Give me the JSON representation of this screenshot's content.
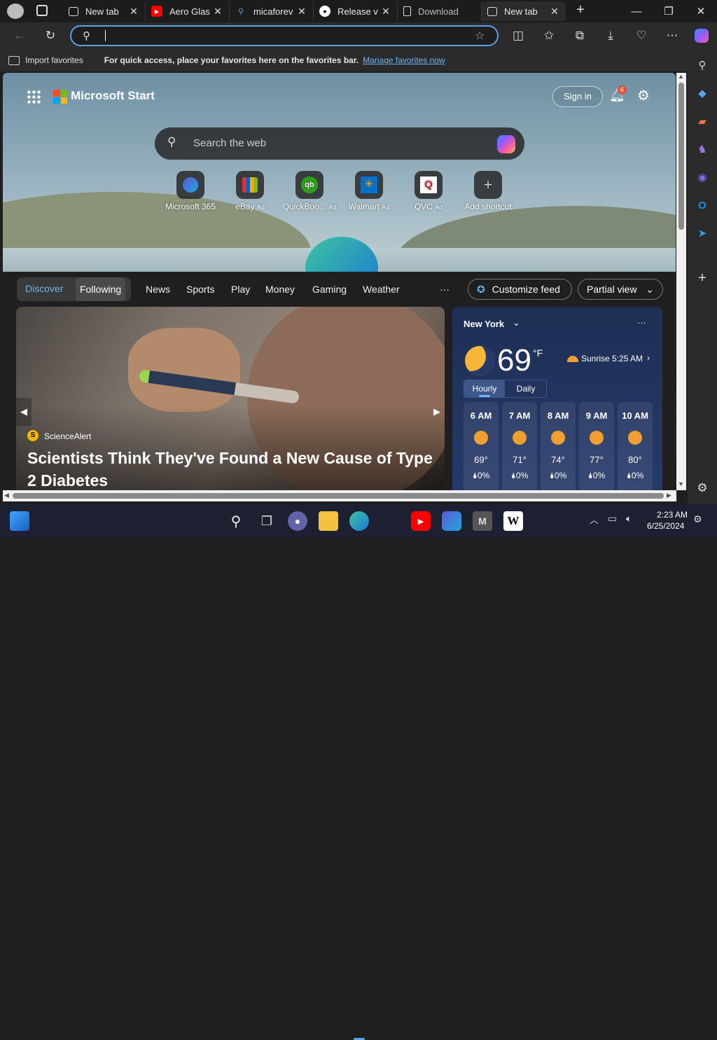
{
  "tabs": [
    {
      "label": "New tab",
      "icon": "newtab-icon"
    },
    {
      "label": "Aero Glas",
      "icon": "youtube-icon"
    },
    {
      "label": "micaforev",
      "icon": "search-icon"
    },
    {
      "label": "Release v",
      "icon": "github-icon"
    },
    {
      "label": "Download",
      "icon": "document-icon"
    },
    {
      "label": "New tab",
      "icon": "newtab-icon"
    }
  ],
  "address": {
    "value": ""
  },
  "favorites": {
    "import_label": "Import favorites",
    "hint": "For quick access, place your favorites here on the favorites bar.",
    "manage_link": "Manage favorites now"
  },
  "start": {
    "brand": "Microsoft Start",
    "sign_in": "Sign in",
    "notif_count": "6",
    "search_placeholder": "Search the web",
    "shortcuts": [
      {
        "label": "Microsoft 365",
        "ad": ""
      },
      {
        "label": "eBay",
        "ad": "Ad"
      },
      {
        "label": "QuickBoo...",
        "ad": "Ad"
      },
      {
        "label": "Walmart",
        "ad": "Ad"
      },
      {
        "label": "QVC",
        "ad": "Ad"
      },
      {
        "label": "Add shortcut",
        "ad": ""
      }
    ]
  },
  "feednav": {
    "discover": "Discover",
    "following": "Following",
    "items": [
      "News",
      "Sports",
      "Play",
      "Money",
      "Gaming",
      "Weather"
    ],
    "more": "···",
    "customize": "Customize feed",
    "view": "Partial view"
  },
  "article": {
    "source": "ScienceAlert",
    "source_initial": "S",
    "headline": "Scientists Think They've Found a New Cause of Type 2 Diabetes"
  },
  "weather": {
    "city": "New York",
    "temp": "69",
    "unit": "°F",
    "sunrise": "Sunrise 5:25 AM",
    "tab_hourly": "Hourly",
    "tab_daily": "Daily",
    "hours": [
      {
        "time": "6 AM",
        "temp": "69°",
        "precip": "0%"
      },
      {
        "time": "7 AM",
        "temp": "71°",
        "precip": "0%"
      },
      {
        "time": "8 AM",
        "temp": "74°",
        "precip": "0%"
      },
      {
        "time": "9 AM",
        "temp": "77°",
        "precip": "0%"
      },
      {
        "time": "10 AM",
        "temp": "80°",
        "precip": "0%"
      }
    ]
  },
  "taskbar": {
    "time": "2:23 AM",
    "date": "6/25/2024"
  },
  "colors": {
    "accent": "#5aa2e8",
    "link": "#6cb4f2",
    "toolbar": "#2b2b2b"
  }
}
